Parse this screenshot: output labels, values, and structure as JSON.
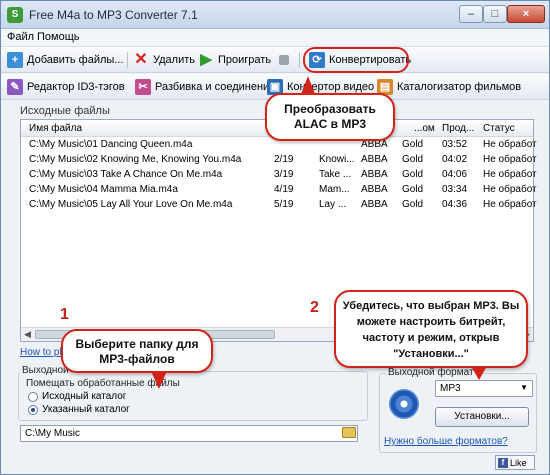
{
  "window": {
    "title": "Free M4a to MP3 Converter 7.1",
    "app_icon": "S",
    "minimize": "–",
    "maximize": "□",
    "close": "×"
  },
  "menu": [
    "Файл",
    "Помощь"
  ],
  "toolbar1": {
    "add": "Добавить файлы...",
    "delete": "Удалить",
    "play": "Проиграть",
    "convert": "Конвертировать"
  },
  "toolbar2": {
    "id3": "Редактор ID3-тэгов",
    "split": "Разбивка и соединение",
    "video": "Конвертор видео",
    "catalog": "Каталогизатор фильмов"
  },
  "files_section": {
    "label": "Исходные файлы"
  },
  "table": {
    "headers": [
      "Имя файла",
      "...ом",
      "Прод...",
      "Статус"
    ],
    "rows": [
      {
        "name": "C:\\My Music\\01 Dancing Queen.m4a",
        "track": "",
        "title": "",
        "artist": "ABBA",
        "album": "Gold",
        "duration": "03:52",
        "status": "Не обработ"
      },
      {
        "name": "C:\\My Music\\02 Knowing Me, Knowing You.m4a",
        "track": "2/19",
        "title": "Knowi...",
        "artist": "ABBA",
        "album": "Gold",
        "duration": "04:02",
        "status": "Не обработ"
      },
      {
        "name": "C:\\My Music\\03 Take A Chance On Me.m4a",
        "track": "3/19",
        "title": "Take ...",
        "artist": "ABBA",
        "album": "Gold",
        "duration": "04:06",
        "status": "Не обработ"
      },
      {
        "name": "C:\\My Music\\04 Mamma Mia.m4a",
        "track": "4/19",
        "title": "Mam...",
        "artist": "ABBA",
        "album": "Gold",
        "duration": "03:34",
        "status": "Не обработ"
      },
      {
        "name": "C:\\My Music\\05 Lay All Your Love On Me.m4a",
        "track": "5/19",
        "title": "Lay ...",
        "artist": "ABBA",
        "album": "Gold",
        "duration": "04:36",
        "status": "Не обработ"
      }
    ]
  },
  "howto_link": "How to pl",
  "numbers": {
    "one": "1",
    "two": "2"
  },
  "output_dir": {
    "section_label": "Выходной",
    "group_label": "Помещать обработанные файлы",
    "opt_source": "Исходный каталог",
    "opt_custom": "Указанный каталог",
    "path": "C:\\My Music"
  },
  "output_format": {
    "label": "Выходной формат",
    "selected": "MP3",
    "settings_button": "Установки...",
    "more_link": "Нужно больше форматов?"
  },
  "callouts": {
    "convert": "Преобразовать ALAC в MP3",
    "folder": "Выберите папку для MP3-файлов",
    "format": "Убедитесь, что выбран MP3. Вы можете настроить битрейт, частоту и режим, открыв \"Установки...\""
  },
  "like": {
    "icon": "f",
    "label": "Like"
  },
  "colors": {
    "accent": "#d2231a",
    "link": "#1b57b5"
  }
}
